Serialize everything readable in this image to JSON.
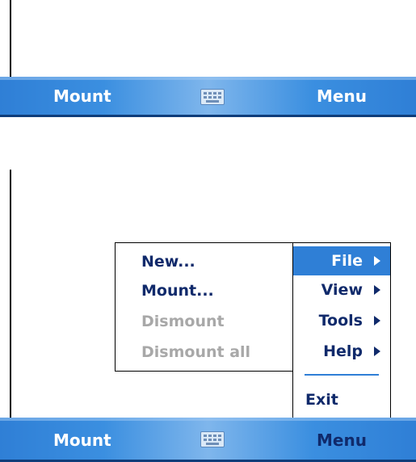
{
  "top_screen": {
    "softbar": {
      "left_label": "Mount",
      "right_label": "Menu",
      "center_icon": "keyboard-icon"
    }
  },
  "bottom_screen": {
    "submenu": {
      "items": [
        {
          "label": "New...",
          "enabled": true
        },
        {
          "label": "Mount...",
          "enabled": true
        },
        {
          "label": "Dismount",
          "enabled": false
        },
        {
          "label": "Dismount all",
          "enabled": false
        }
      ]
    },
    "main_menu": {
      "items": [
        {
          "label": "File",
          "has_submenu": true,
          "selected": true
        },
        {
          "label": "View",
          "has_submenu": true
        },
        {
          "label": "Tools",
          "has_submenu": true
        },
        {
          "label": "Help",
          "has_submenu": true
        },
        {
          "label": "Exit",
          "has_submenu": false
        }
      ]
    },
    "softbar": {
      "left_label": "Mount",
      "right_label": "Menu",
      "center_icon": "keyboard-icon"
    }
  },
  "colors": {
    "accent": "#2f7fd6",
    "menu_text": "#102a6b",
    "disabled_text": "#a8a8a8"
  }
}
